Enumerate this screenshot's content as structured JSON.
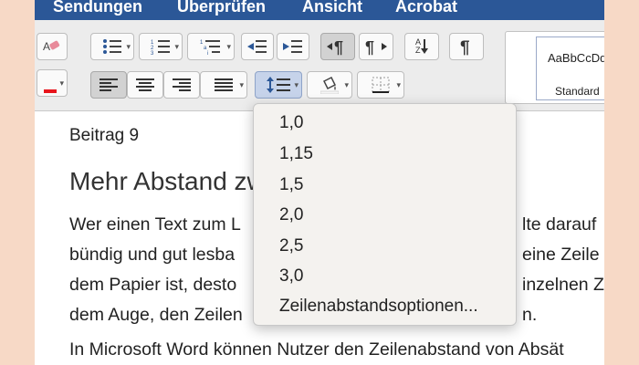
{
  "ribbon": {
    "tabs": [
      "Sendungen",
      "Überprüfen",
      "Ansicht",
      "Acrobat"
    ]
  },
  "toolbar": {
    "icons": [
      "eraser-icon",
      "font-color-icon",
      "bullets-icon",
      "numbering-icon",
      "multilevel-list-icon",
      "decrease-indent-icon",
      "increase-indent-icon",
      "ltr-paragraph-icon",
      "rtl-paragraph-icon",
      "sort-icon",
      "pilcrow-icon",
      "align-left-icon",
      "align-center-icon",
      "align-right-icon",
      "justify-icon",
      "line-spacing-icon",
      "shading-icon",
      "borders-icon"
    ],
    "sort_letters": {
      "top": "A",
      "bottom": "Z"
    },
    "font_color": "#e8141c",
    "accent": "#2b5797"
  },
  "styles_gallery": {
    "sample": "AaBbCcDd",
    "style_name": "Standard"
  },
  "document": {
    "label": "Beitrag 9",
    "heading": "Mehr Abstand zw",
    "paragraph1": [
      "Wer einen Text zum L",
      "bündig und gut lesba",
      "dem Papier ist, desto",
      "dem Auge, den Zeilen"
    ],
    "paragraph1_right": [
      "lte darauf",
      "eine Zeile",
      "inzelnen Z",
      "n."
    ],
    "paragraph2": "In Microsoft Word können Nutzer den Zeilenabstand von Absät"
  },
  "line_spacing_menu": {
    "items": [
      "1,0",
      "1,15",
      "1,5",
      "2,0",
      "2,5",
      "3,0",
      "Zeilenabstandsoptionen..."
    ]
  }
}
